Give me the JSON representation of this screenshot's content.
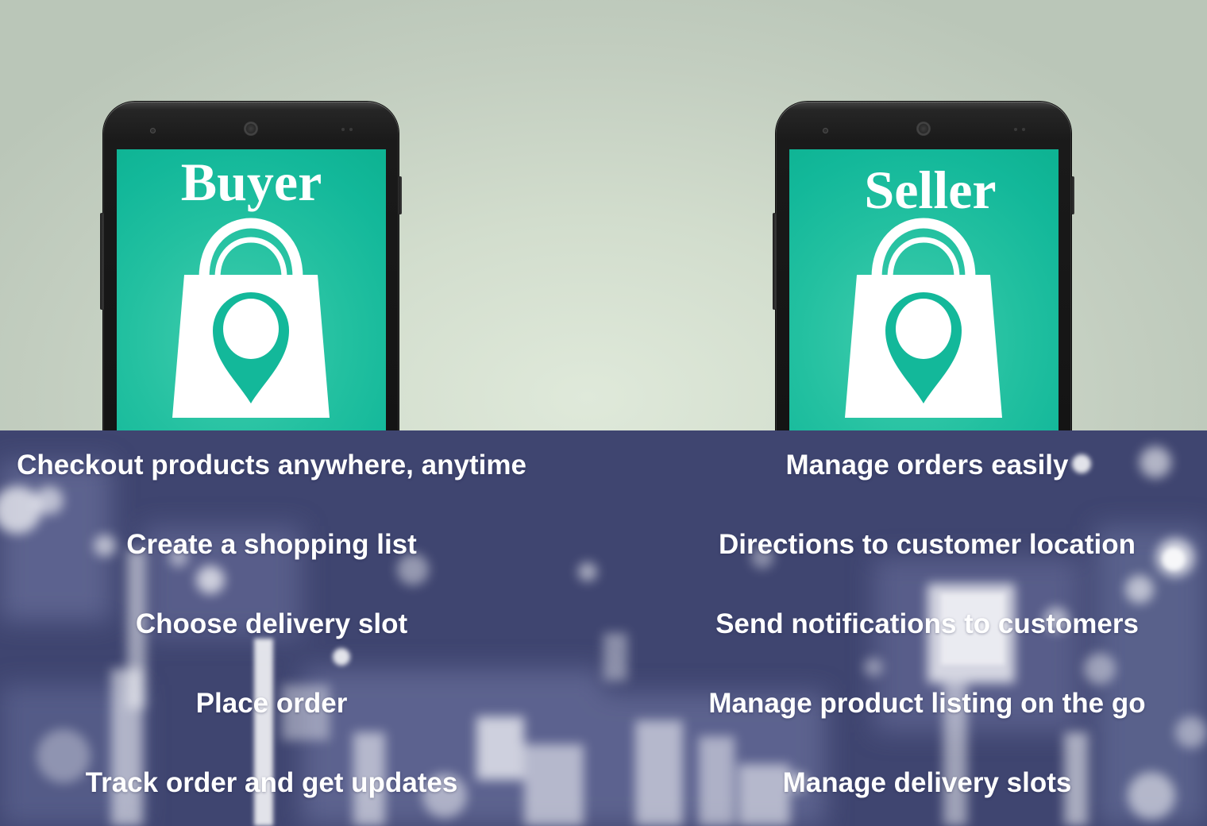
{
  "colors": {
    "screen_teal": "#13b89a",
    "panel_navy": "#3f4570",
    "text": "#ffffff"
  },
  "phones": {
    "buyer": {
      "title": "Buyer",
      "icon": "shopping-bag-location-icon"
    },
    "seller": {
      "title": "Seller",
      "icon": "shopping-bag-location-icon"
    }
  },
  "features": {
    "buyer": [
      "Checkout products anywhere, anytime",
      "Create a shopping list",
      "Choose delivery slot",
      "Place order",
      "Track order and get updates"
    ],
    "seller": [
      "Manage orders easily",
      "Directions to customer location",
      "Send notifications to customers",
      "Manage product listing on the go",
      "Manage delivery slots"
    ]
  }
}
